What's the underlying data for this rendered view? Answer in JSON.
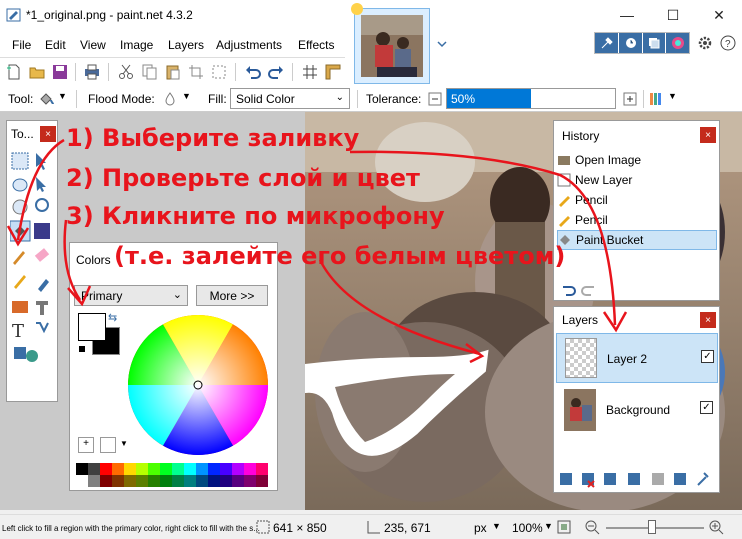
{
  "window": {
    "title": "*1_original.png - paint.net 4.3.2",
    "minimize": "—",
    "maximize": "☐",
    "close": "✕"
  },
  "menu": [
    "File",
    "Edit",
    "View",
    "Image",
    "Layers",
    "Adjustments",
    "Effects"
  ],
  "toolbar2": {
    "tool_label": "Tool:",
    "flood_mode_label": "Flood Mode:",
    "fill_label": "Fill:",
    "fill_value": "Solid Color",
    "tolerance_label": "Tolerance:",
    "tolerance_value": "50%",
    "tolerance_fraction": 0.5
  },
  "tools_window": {
    "title": "To..."
  },
  "colors_window": {
    "title": "Colors",
    "primary_select": "Primary",
    "more_button": "More >>",
    "palette": [
      "#000000",
      "#404040",
      "#ff0000",
      "#ff6a00",
      "#ffd800",
      "#b6ff00",
      "#4cff00",
      "#00ff21",
      "#00ff90",
      "#00ffff",
      "#0094ff",
      "#0026ff",
      "#4800ff",
      "#b200ff",
      "#ff00dc",
      "#ff006e",
      "#ffffff",
      "#808080",
      "#7f0000",
      "#7f3300",
      "#7f6a00",
      "#5b7f00",
      "#267f00",
      "#007f0e",
      "#007f46",
      "#007f7f",
      "#004a7f",
      "#00137f",
      "#21007f",
      "#57007f",
      "#7f006e",
      "#7f0037"
    ]
  },
  "history": {
    "title": "History",
    "items": [
      "Open Image",
      "New Layer",
      "Pencil",
      "Pencil",
      "Paint Bucket"
    ]
  },
  "layers": {
    "title": "Layers",
    "items": [
      "Layer 2",
      "Background"
    ]
  },
  "status": {
    "hint": "Left click to fill a region with the primary color, right click to fill with the s...",
    "image_size": "641 × 850",
    "cursor_pos": "235, 671",
    "units": "px",
    "zoom": "100%"
  },
  "annotations": {
    "line1": "1) Выберите заливку",
    "line2": "2) Проверьте слой и цвет",
    "line3": "3) Кликните по микрофону",
    "line4": "(т.е. залейте его белым цветом)"
  },
  "colors": {
    "accent": "#0078d7",
    "annotation": "#e8141c",
    "close_button": "#c42b1c"
  }
}
